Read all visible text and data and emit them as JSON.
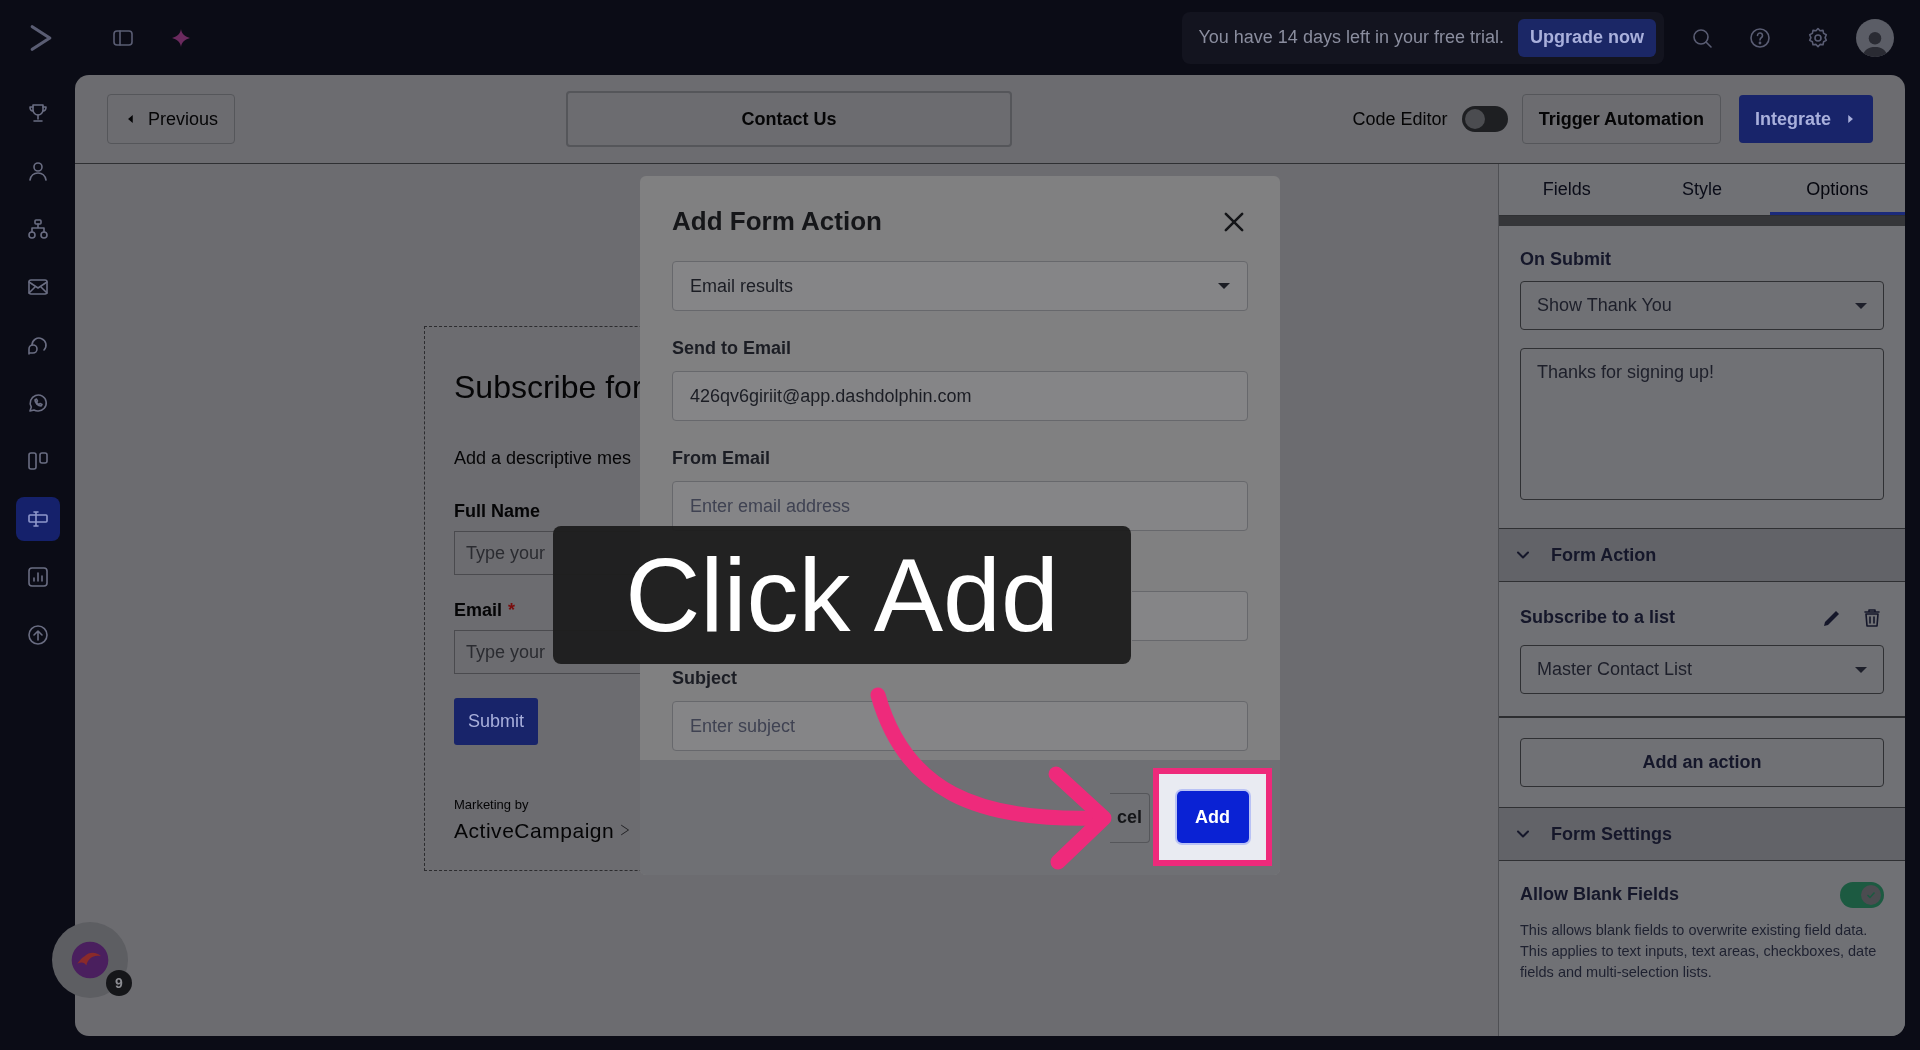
{
  "top_bar": {
    "trial_text": "You have 14 days left in your free trial.",
    "upgrade_button": "Upgrade now"
  },
  "sidebar": {
    "items": [
      {
        "kind": "trophy",
        "selected": false
      },
      {
        "kind": "person",
        "selected": false
      },
      {
        "kind": "hierarchy",
        "selected": false
      },
      {
        "kind": "mail",
        "selected": false
      },
      {
        "kind": "chat",
        "selected": false
      },
      {
        "kind": "whatsapp",
        "selected": false
      },
      {
        "kind": "columns",
        "selected": false
      },
      {
        "kind": "form",
        "selected": true
      },
      {
        "kind": "chart",
        "selected": false
      },
      {
        "kind": "upload",
        "selected": false
      }
    ]
  },
  "header": {
    "previous": "Previous",
    "form_name": "Contact Us",
    "code_editor": {
      "label": "Code Editor",
      "on": false
    },
    "trigger": "Trigger Automation",
    "integrate": "Integrate"
  },
  "form_preview": {
    "title": "Subscribe for",
    "description": "Add a descriptive mes",
    "fields": [
      {
        "label": "Full Name",
        "placeholder": "Type your"
      },
      {
        "label": "Email",
        "required_mark": "*",
        "placeholder": "Type your"
      }
    ],
    "submit": "Submit",
    "marketing_by": "Marketing by",
    "brand": "ActiveCampaign"
  },
  "tabs": [
    {
      "label": "Fields",
      "selected": false
    },
    {
      "label": "Style",
      "selected": false
    },
    {
      "label": "Options",
      "selected": true
    }
  ],
  "options": {
    "on_submit_label": "On Submit",
    "on_submit_value": "Show Thank You",
    "thank_you_text": "Thanks for signing up!",
    "form_action": {
      "title": "Form Action",
      "expanded": true,
      "action_title": "Subscribe to a list",
      "list_value": "Master Contact List",
      "add_action": "Add an action"
    },
    "form_settings": {
      "title": "Form Settings",
      "expanded": true,
      "allow_blank_label": "Allow Blank Fields",
      "allow_blank_on": true,
      "allow_blank_help": "This allows blank fields to overwrite existing field data. This applies to text inputs, text areas, checkboxes, date fields and multi-selection lists."
    }
  },
  "modal": {
    "title": "Add Form Action",
    "action_type": "Email results",
    "fields": [
      {
        "kind": "field",
        "label": "Send to Email",
        "value": "426qv6giriit@app.dashdolphin.com"
      },
      {
        "kind": "field",
        "label": "From Email",
        "placeholder": "Enter email address"
      },
      {
        "kind": "covered"
      },
      {
        "kind": "field",
        "label": "Subject",
        "placeholder": "Enter subject"
      }
    ],
    "cancel": "cel",
    "add": "Add"
  },
  "callout": {
    "text": "Click Add"
  },
  "chat_widget": {
    "badge": "9"
  }
}
